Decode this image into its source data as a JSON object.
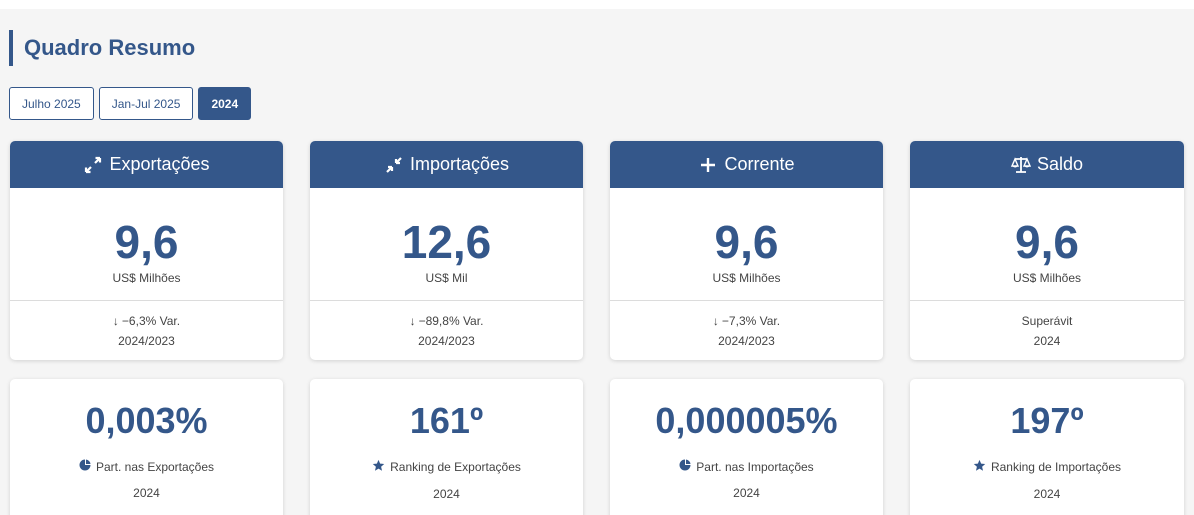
{
  "header": {
    "title": "Quadro Resumo"
  },
  "tabs": [
    {
      "label": "Julho 2025",
      "active": false
    },
    {
      "label": "Jan-Jul 2025",
      "active": false
    },
    {
      "label": "2024",
      "active": true
    }
  ],
  "cards": [
    {
      "title": "Exportações",
      "icon": "expand-arrows-icon",
      "value": "9,6",
      "unit": "US$ Milhões",
      "foot1": "−6,3% Var.",
      "foot2": "2024/2023",
      "arrow": "down"
    },
    {
      "title": "Importações",
      "icon": "compress-arrows-icon",
      "value": "12,6",
      "unit": "US$ Mil",
      "foot1": "−89,8% Var.",
      "foot2": "2024/2023",
      "arrow": "down"
    },
    {
      "title": "Corrente",
      "icon": "plus-icon",
      "value": "9,6",
      "unit": "US$ Milhões",
      "foot1": "−7,3% Var.",
      "foot2": "2024/2023",
      "arrow": "down"
    },
    {
      "title": "Saldo",
      "icon": "scale-balance-icon",
      "value": "9,6",
      "unit": "US$ Milhões",
      "foot1": "Superávit",
      "foot2": "2024",
      "arrow": "none"
    }
  ],
  "stats": [
    {
      "value": "0,003%",
      "label": "Part. nas Exportações",
      "year": "2024",
      "icon": "pie-chart-icon"
    },
    {
      "value": "161º",
      "label": "Ranking de Exportações",
      "year": "2024",
      "icon": "star-icon"
    },
    {
      "value": "0,000005%",
      "label": "Part. nas Importações",
      "year": "2024",
      "icon": "pie-chart-icon"
    },
    {
      "value": "197º",
      "label": "Ranking de Importações",
      "year": "2024",
      "icon": "star-icon"
    }
  ],
  "colors": {
    "primary": "#34578a",
    "background": "#f5f5f5"
  }
}
